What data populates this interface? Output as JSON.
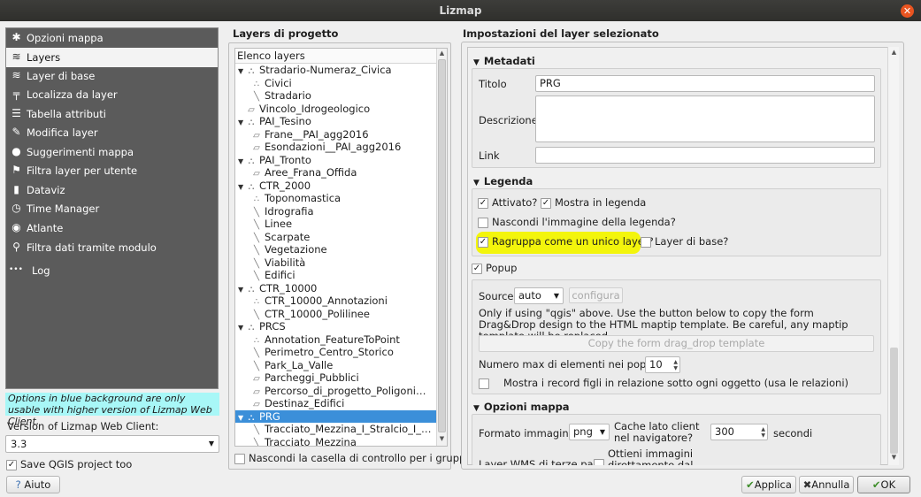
{
  "window": {
    "title": "Lizmap"
  },
  "nav": {
    "items": [
      {
        "label": "Opzioni mappa",
        "icon": "✱"
      },
      {
        "label": "Layers",
        "icon": "≋"
      },
      {
        "label": "Layer di base",
        "icon": "≋"
      },
      {
        "label": "Localizza da layer",
        "icon": "╤"
      },
      {
        "label": "Tabella attributi",
        "icon": "☰"
      },
      {
        "label": "Modifica layer",
        "icon": "✎"
      },
      {
        "label": "Suggerimenti mappa",
        "icon": "●"
      },
      {
        "label": "Filtra layer per utente",
        "icon": "⚑"
      },
      {
        "label": "Dataviz",
        "icon": "▮"
      },
      {
        "label": "Time Manager",
        "icon": "◷"
      },
      {
        "label": "Atlante",
        "icon": "◉"
      },
      {
        "label": "Filtra dati tramite modulo",
        "icon": "⚲"
      },
      {
        "label": "Log",
        "icon": "•••"
      }
    ],
    "active_index": 1
  },
  "hint": "Options in blue background are only usable with higher version of Lizmap Web Client.",
  "version": {
    "label": "Version of Lizmap Web Client:",
    "value": "3.3"
  },
  "save_project": {
    "label": "Save QGIS project too",
    "checked": true
  },
  "help_button": "Aiuto",
  "layers_panel": {
    "title": "Layers di progetto",
    "header": "Elenco layers",
    "rows": [
      {
        "label": "Stradario-Numeraz_Civica",
        "level": 0,
        "kind": "group",
        "expanded": true
      },
      {
        "label": "Civici",
        "level": 1,
        "kind": "point"
      },
      {
        "label": "Stradario",
        "level": 1,
        "kind": "line"
      },
      {
        "label": "Vincolo_Idrogeologico",
        "level": 0,
        "kind": "polygon"
      },
      {
        "label": "PAI_Tesino",
        "level": 0,
        "kind": "group",
        "expanded": true
      },
      {
        "label": "Frane__PAI_agg2016",
        "level": 1,
        "kind": "polygon"
      },
      {
        "label": "Esondazioni__PAI_agg2016",
        "level": 1,
        "kind": "polygon"
      },
      {
        "label": "PAI_Tronto",
        "level": 0,
        "kind": "group",
        "expanded": true
      },
      {
        "label": "Aree_Frana_Offida",
        "level": 1,
        "kind": "polygon"
      },
      {
        "label": "CTR_2000",
        "level": 0,
        "kind": "group",
        "expanded": true
      },
      {
        "label": "Toponomastica",
        "level": 1,
        "kind": "point"
      },
      {
        "label": "Idrografia",
        "level": 1,
        "kind": "line"
      },
      {
        "label": "Linee",
        "level": 1,
        "kind": "line"
      },
      {
        "label": "Scarpate",
        "level": 1,
        "kind": "line"
      },
      {
        "label": "Vegetazione",
        "level": 1,
        "kind": "line"
      },
      {
        "label": "Viabilità",
        "level": 1,
        "kind": "line"
      },
      {
        "label": "Edifici",
        "level": 1,
        "kind": "line"
      },
      {
        "label": "CTR_10000",
        "level": 0,
        "kind": "group",
        "expanded": true
      },
      {
        "label": "CTR_10000_Annotazioni",
        "level": 1,
        "kind": "point"
      },
      {
        "label": "CTR_10000_Polilinee",
        "level": 1,
        "kind": "line"
      },
      {
        "label": "PRCS",
        "level": 0,
        "kind": "group",
        "expanded": true
      },
      {
        "label": "Annotation_FeatureToPoint",
        "level": 1,
        "kind": "point"
      },
      {
        "label": "Perimetro_Centro_Storico",
        "level": 1,
        "kind": "line"
      },
      {
        "label": "Park_La_Valle",
        "level": 1,
        "kind": "line"
      },
      {
        "label": "Parcheggi_Pubblici",
        "level": 1,
        "kind": "polygon"
      },
      {
        "label": "Percorso_di_progetto_Poligoni…",
        "level": 1,
        "kind": "polygon"
      },
      {
        "label": "Destinaz_Edifici",
        "level": 1,
        "kind": "polygon"
      },
      {
        "label": "PRG",
        "level": 0,
        "kind": "group",
        "expanded": true,
        "selected": true
      },
      {
        "label": "Tracciato_Mezzina_I_Stralcio_I_…",
        "level": 1,
        "kind": "line"
      },
      {
        "label": "Tracciato_Mezzina",
        "level": 1,
        "kind": "line"
      }
    ],
    "groups_checkbox": "Nascondi la casella di controllo per i gruppi"
  },
  "settings": {
    "title": "Impostazioni del layer selezionato",
    "metadata": {
      "heading": "Metadati",
      "titolo_label": "Titolo",
      "titolo_value": "PRG",
      "descrizione_label": "Descrizione",
      "descrizione_value": "",
      "link_label": "Link",
      "link_value": ""
    },
    "legend": {
      "heading": "Legenda",
      "attivato": "Attivato?",
      "mostra": "Mostra in legenda",
      "nascondi": "Nascondi l'immagine della legenda?",
      "ragruppa": "Ragruppa come un unico layer?",
      "layer_base": "Layer di base?"
    },
    "popup": {
      "heading": "Popup",
      "source_label": "Source",
      "source_value": "auto",
      "configura": "configura",
      "info": "Only if using \"qgis\" above. Use the button below to copy the form Drag&Drop design to the HTML maptip template. Be careful, any maptip template will be replaced.",
      "copy_button": "Copy the form drag_drop template",
      "max_label": "Numero max di elementi nei popup",
      "max_value": "10",
      "children_label": "Mostra i record figli in relazione sotto ogni oggetto (usa le relazioni)"
    },
    "map_options": {
      "heading": "Opzioni mappa",
      "format_label": "Formato immagine",
      "format_value": "png",
      "cache_label": "Cache lato client nel navigatore?",
      "cache_value": "300",
      "seconds": "secondi",
      "wms_label": "Layer WMS di terze parti",
      "ottieni_label": "Ottieni immagini direttamente dal server"
    }
  },
  "buttons": {
    "apply": "Applica",
    "cancel": "Annulla",
    "ok": "OK"
  }
}
